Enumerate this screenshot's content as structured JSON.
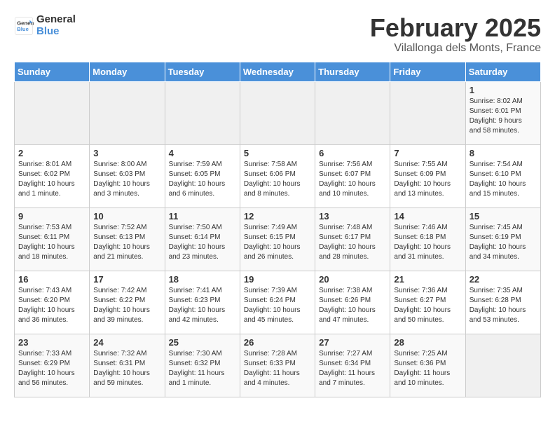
{
  "logo": {
    "line1": "General",
    "line2": "Blue"
  },
  "title": "February 2025",
  "subtitle": "Vilallonga dels Monts, France",
  "weekdays": [
    "Sunday",
    "Monday",
    "Tuesday",
    "Wednesday",
    "Thursday",
    "Friday",
    "Saturday"
  ],
  "weeks": [
    [
      {
        "day": "",
        "info": ""
      },
      {
        "day": "",
        "info": ""
      },
      {
        "day": "",
        "info": ""
      },
      {
        "day": "",
        "info": ""
      },
      {
        "day": "",
        "info": ""
      },
      {
        "day": "",
        "info": ""
      },
      {
        "day": "1",
        "info": "Sunrise: 8:02 AM\nSunset: 6:01 PM\nDaylight: 9 hours\nand 58 minutes."
      }
    ],
    [
      {
        "day": "2",
        "info": "Sunrise: 8:01 AM\nSunset: 6:02 PM\nDaylight: 10 hours\nand 1 minute."
      },
      {
        "day": "3",
        "info": "Sunrise: 8:00 AM\nSunset: 6:03 PM\nDaylight: 10 hours\nand 3 minutes."
      },
      {
        "day": "4",
        "info": "Sunrise: 7:59 AM\nSunset: 6:05 PM\nDaylight: 10 hours\nand 6 minutes."
      },
      {
        "day": "5",
        "info": "Sunrise: 7:58 AM\nSunset: 6:06 PM\nDaylight: 10 hours\nand 8 minutes."
      },
      {
        "day": "6",
        "info": "Sunrise: 7:56 AM\nSunset: 6:07 PM\nDaylight: 10 hours\nand 10 minutes."
      },
      {
        "day": "7",
        "info": "Sunrise: 7:55 AM\nSunset: 6:09 PM\nDaylight: 10 hours\nand 13 minutes."
      },
      {
        "day": "8",
        "info": "Sunrise: 7:54 AM\nSunset: 6:10 PM\nDaylight: 10 hours\nand 15 minutes."
      }
    ],
    [
      {
        "day": "9",
        "info": "Sunrise: 7:53 AM\nSunset: 6:11 PM\nDaylight: 10 hours\nand 18 minutes."
      },
      {
        "day": "10",
        "info": "Sunrise: 7:52 AM\nSunset: 6:13 PM\nDaylight: 10 hours\nand 21 minutes."
      },
      {
        "day": "11",
        "info": "Sunrise: 7:50 AM\nSunset: 6:14 PM\nDaylight: 10 hours\nand 23 minutes."
      },
      {
        "day": "12",
        "info": "Sunrise: 7:49 AM\nSunset: 6:15 PM\nDaylight: 10 hours\nand 26 minutes."
      },
      {
        "day": "13",
        "info": "Sunrise: 7:48 AM\nSunset: 6:17 PM\nDaylight: 10 hours\nand 28 minutes."
      },
      {
        "day": "14",
        "info": "Sunrise: 7:46 AM\nSunset: 6:18 PM\nDaylight: 10 hours\nand 31 minutes."
      },
      {
        "day": "15",
        "info": "Sunrise: 7:45 AM\nSunset: 6:19 PM\nDaylight: 10 hours\nand 34 minutes."
      }
    ],
    [
      {
        "day": "16",
        "info": "Sunrise: 7:43 AM\nSunset: 6:20 PM\nDaylight: 10 hours\nand 36 minutes."
      },
      {
        "day": "17",
        "info": "Sunrise: 7:42 AM\nSunset: 6:22 PM\nDaylight: 10 hours\nand 39 minutes."
      },
      {
        "day": "18",
        "info": "Sunrise: 7:41 AM\nSunset: 6:23 PM\nDaylight: 10 hours\nand 42 minutes."
      },
      {
        "day": "19",
        "info": "Sunrise: 7:39 AM\nSunset: 6:24 PM\nDaylight: 10 hours\nand 45 minutes."
      },
      {
        "day": "20",
        "info": "Sunrise: 7:38 AM\nSunset: 6:26 PM\nDaylight: 10 hours\nand 47 minutes."
      },
      {
        "day": "21",
        "info": "Sunrise: 7:36 AM\nSunset: 6:27 PM\nDaylight: 10 hours\nand 50 minutes."
      },
      {
        "day": "22",
        "info": "Sunrise: 7:35 AM\nSunset: 6:28 PM\nDaylight: 10 hours\nand 53 minutes."
      }
    ],
    [
      {
        "day": "23",
        "info": "Sunrise: 7:33 AM\nSunset: 6:29 PM\nDaylight: 10 hours\nand 56 minutes."
      },
      {
        "day": "24",
        "info": "Sunrise: 7:32 AM\nSunset: 6:31 PM\nDaylight: 10 hours\nand 59 minutes."
      },
      {
        "day": "25",
        "info": "Sunrise: 7:30 AM\nSunset: 6:32 PM\nDaylight: 11 hours\nand 1 minute."
      },
      {
        "day": "26",
        "info": "Sunrise: 7:28 AM\nSunset: 6:33 PM\nDaylight: 11 hours\nand 4 minutes."
      },
      {
        "day": "27",
        "info": "Sunrise: 7:27 AM\nSunset: 6:34 PM\nDaylight: 11 hours\nand 7 minutes."
      },
      {
        "day": "28",
        "info": "Sunrise: 7:25 AM\nSunset: 6:36 PM\nDaylight: 11 hours\nand 10 minutes."
      },
      {
        "day": "",
        "info": ""
      }
    ]
  ]
}
